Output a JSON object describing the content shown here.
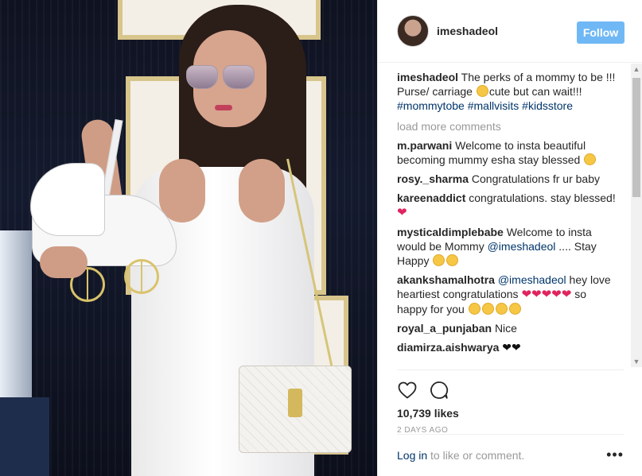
{
  "colors": {
    "follow": "#70b8f5",
    "link": "#003569",
    "muted": "#999999",
    "heart": "#e0245e"
  },
  "header": {
    "username": "imeshadeol",
    "follow_label": "Follow"
  },
  "caption": {
    "user": "imeshadeol",
    "text_1": "The perks of a mommy to be !!! Purse/ carriage",
    "text_2": "cute but can wait!!!",
    "tags": [
      "#mommytobe",
      "#mallvisits",
      "#kidsstore"
    ]
  },
  "load_more": "load more comments",
  "comments": [
    {
      "user": "m.parwani",
      "text": "Welcome to insta beautiful becoming mummy esha stay blessed"
    },
    {
      "user": "rosy._sharma",
      "text": "Congratulations fr ur baby"
    },
    {
      "user": "kareenaddict",
      "text": "congratulations. stay blessed!"
    },
    {
      "user": "mysticaldimplebabe",
      "text": "Welcome to insta would be Mommy",
      "mention": "@imeshadeol",
      "text_after": ".... Stay Happy"
    },
    {
      "user": "akankshamalhotra",
      "mention": "@imeshadeol",
      "text": "hey love heartiest congratulations",
      "text_after": "so happy for you"
    },
    {
      "user": "royal_a_punjaban",
      "text": "Nice"
    },
    {
      "user": "diamirza.aishwarya",
      "text": ""
    }
  ],
  "icons": {
    "like": "heart-outline-icon",
    "comment": "comment-bubble-icon",
    "more": "more-dots-icon"
  },
  "likes": "10,739 likes",
  "timestamp": "2 DAYS AGO",
  "footer": {
    "login": "Log in",
    "suffix": "to like or comment.",
    "more": "•••"
  }
}
